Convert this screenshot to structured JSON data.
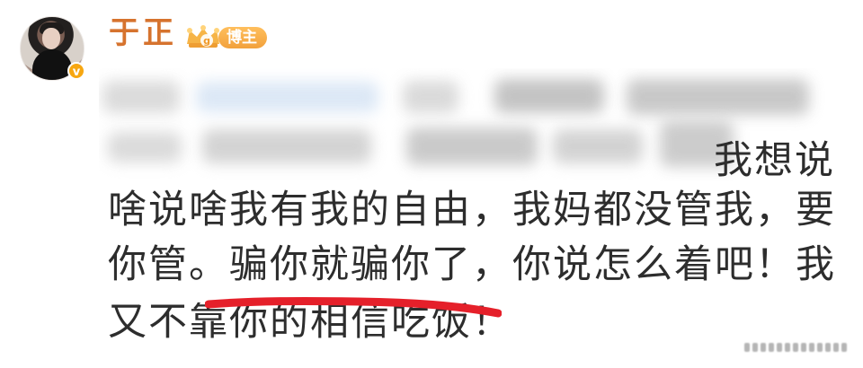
{
  "profile": {
    "username": "于正",
    "badge_label": "博主",
    "avatar_icon": "avatar-icon",
    "verified_icon": "verified-badge-icon",
    "badge_icon": "crown-icon",
    "accent_color": "#d6732e",
    "badge_color": "#f2a13c"
  },
  "post": {
    "visible_fragment": "我想说",
    "lines": [
      "啥说啥我有我的自由，我妈都没管我，要",
      "你管。骗你就骗你了，你说怎么着吧！我",
      "又不靠你的相信吃饭！"
    ],
    "highlight": "骗你就骗你了，",
    "highlight_color": "#e5202a"
  },
  "watermark": {
    "icon": "watermark-icon"
  }
}
